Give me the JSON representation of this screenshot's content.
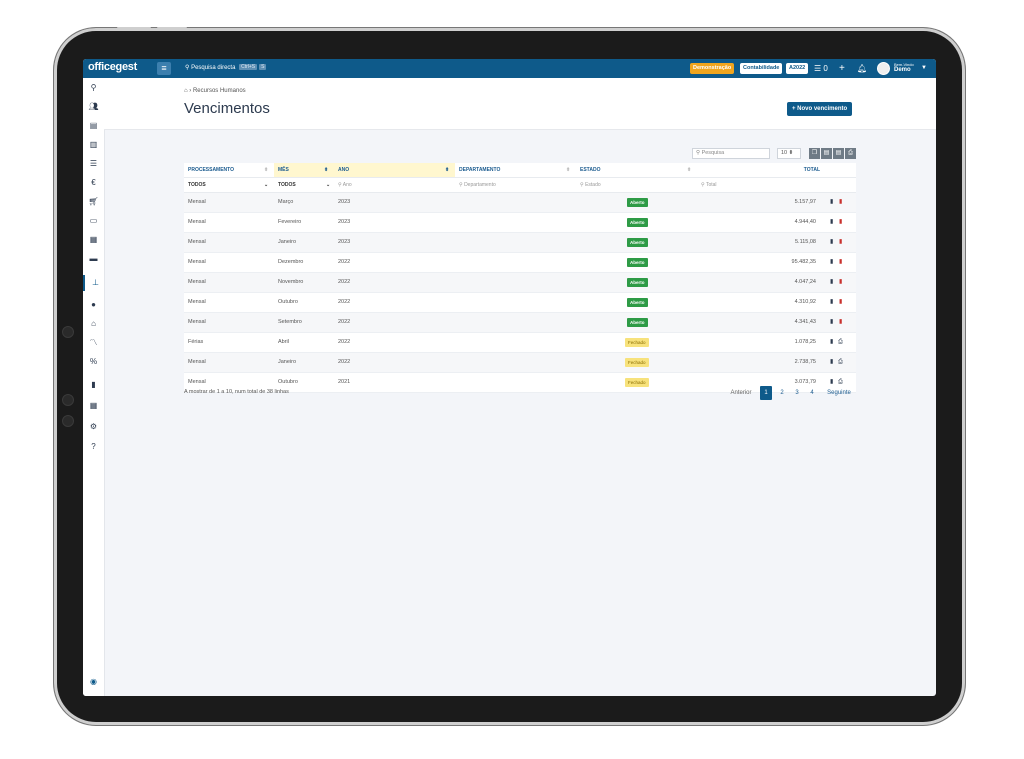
{
  "app": {
    "logo": "officegest"
  },
  "topbar": {
    "search_label": "Pesquisa directa",
    "search_shortcut": [
      "Ctrl+S",
      "S"
    ],
    "mode_demo": "Demonstração",
    "mode_accounting": "Contabilidade",
    "year": "A2022",
    "messages_count": "0",
    "greeting": "Bem-Vindo",
    "user": "Demo"
  },
  "breadcrumb": {
    "section": "Recursos Humanos"
  },
  "page": {
    "title": "Vencimentos",
    "new_button": "+ Novo vencimento"
  },
  "toolbar": {
    "search_placeholder": "Pesquisa",
    "page_length": "10"
  },
  "table": {
    "columns": [
      "PROCESSAMENTO",
      "MÊS",
      "ANO",
      "DEPARTAMENTO",
      "ESTADO",
      "TOTAL"
    ],
    "filters": {
      "processamento": "TODOS",
      "mes": "TODOS",
      "ano_placeholder": "Ano",
      "departamento_placeholder": "Departamento",
      "estado_placeholder": "Estado",
      "total_placeholder": "Total"
    },
    "rows": [
      {
        "processamento": "Mensal",
        "mes": "Março",
        "ano": "2023",
        "departamento": "",
        "estado": "Aberto",
        "total": "5.157,97"
      },
      {
        "processamento": "Mensal",
        "mes": "Fevereiro",
        "ano": "2023",
        "departamento": "",
        "estado": "Aberto",
        "total": "4.944,40"
      },
      {
        "processamento": "Mensal",
        "mes": "Janeiro",
        "ano": "2023",
        "departamento": "",
        "estado": "Aberto",
        "total": "5.115,08"
      },
      {
        "processamento": "Mensal",
        "mes": "Dezembro",
        "ano": "2022",
        "departamento": "",
        "estado": "Aberto",
        "total": "95.482,35"
      },
      {
        "processamento": "Mensal",
        "mes": "Novembro",
        "ano": "2022",
        "departamento": "",
        "estado": "Aberto",
        "total": "4.047,24"
      },
      {
        "processamento": "Mensal",
        "mes": "Outubro",
        "ano": "2022",
        "departamento": "",
        "estado": "Aberto",
        "total": "4.310,92"
      },
      {
        "processamento": "Mensal",
        "mes": "Setembro",
        "ano": "2022",
        "departamento": "",
        "estado": "Aberto",
        "total": "4.341,43"
      },
      {
        "processamento": "Férias",
        "mes": "Abril",
        "ano": "2022",
        "departamento": "",
        "estado": "Fechado",
        "total": "1.078,25"
      },
      {
        "processamento": "Mensal",
        "mes": "Janeiro",
        "ano": "2022",
        "departamento": "",
        "estado": "Fechado",
        "total": "2.738,75"
      },
      {
        "processamento": "Mensal",
        "mes": "Outubro",
        "ano": "2021",
        "departamento": "",
        "estado": "Fechado",
        "total": "3.073,79"
      }
    ]
  },
  "footer": {
    "summary": "A mostrar de 1 a 10, num total de 38 linhas",
    "prev": "Anterior",
    "pages": [
      "1",
      "2",
      "3",
      "4"
    ],
    "next": "Seguinte"
  },
  "colors": {
    "primary": "#0e5a8a",
    "open": "#2e9b46",
    "closed": "#f7e27c",
    "demo": "#f0a51e",
    "delete": "#c9302c"
  },
  "sidebar_icons": [
    "search-icon",
    "users-icon",
    "book-icon",
    "stock-icon",
    "list-icon",
    "euro-icon",
    "cart-icon",
    "cash-icon",
    "calculator-icon",
    "truck-icon",
    "hierarchy-icon",
    "clock-icon",
    "bank-icon",
    "chart-icon",
    "tax-icon",
    "document-icon",
    "table-icon",
    "gears-icon",
    "help-icon"
  ]
}
